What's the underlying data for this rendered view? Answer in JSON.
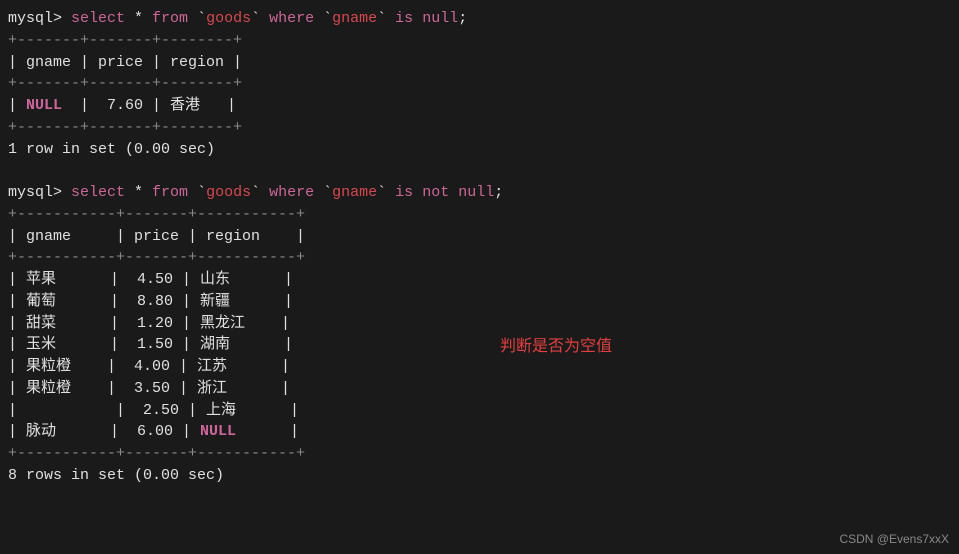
{
  "query1": {
    "prompt": "mysql> ",
    "select": "select",
    "star": " * ",
    "from": "from",
    "table_bt1": " `",
    "table": "goods",
    "table_bt2": "` ",
    "where": "where",
    "col_bt1": " `",
    "col": "gname",
    "col_bt2": "` ",
    "is": "is",
    "sp": " ",
    "null": "null",
    "semi": ";"
  },
  "table1": {
    "border_top": "+-------+-------+--------+",
    "header": "| gname | price | region |",
    "border_mid": "+-------+-------+--------+",
    "row1_pre": "| ",
    "row1_null": "NULL",
    "row1_rest": "  |  7.60 | 香港   |",
    "border_bot": "+-------+-------+--------+",
    "status": "1 row in set (0.00 sec)"
  },
  "query2": {
    "prompt": "mysql> ",
    "select": "select",
    "star": " * ",
    "from": "from",
    "table_bt1": " `",
    "table": "goods",
    "table_bt2": "` ",
    "where": "where",
    "col_bt1": " `",
    "col": "gname",
    "col_bt2": "` ",
    "is": "is",
    "sp1": " ",
    "not": "not",
    "sp2": " ",
    "null": "null",
    "semi": ";"
  },
  "table2": {
    "border_top": "+-----------+-------+-----------+",
    "header": "| gname     | price | region    |",
    "border_mid": "+-----------+-------+-----------+",
    "r1": "| 苹果      |  4.50 | 山东      |",
    "r2": "| 葡萄      |  8.80 | 新疆      |",
    "r3": "| 甜菜      |  1.20 | 黑龙江    |",
    "r4": "| 玉米      |  1.50 | 湖南      |",
    "r5": "| 果粒橙    |  4.00 | 江苏      |",
    "r6": "| 果粒橙    |  3.50 | 浙江      |",
    "r7": "|           |  2.50 | 上海      |",
    "r8_pre": "| 脉动      |  6.00 | ",
    "r8_null": "NULL",
    "r8_post": "      |",
    "border_bot": "+-----------+-------+-----------+",
    "status": "8 rows in set (0.00 sec)"
  },
  "annotation": "判断是否为空值",
  "watermark": "CSDN @Evens7xxX"
}
